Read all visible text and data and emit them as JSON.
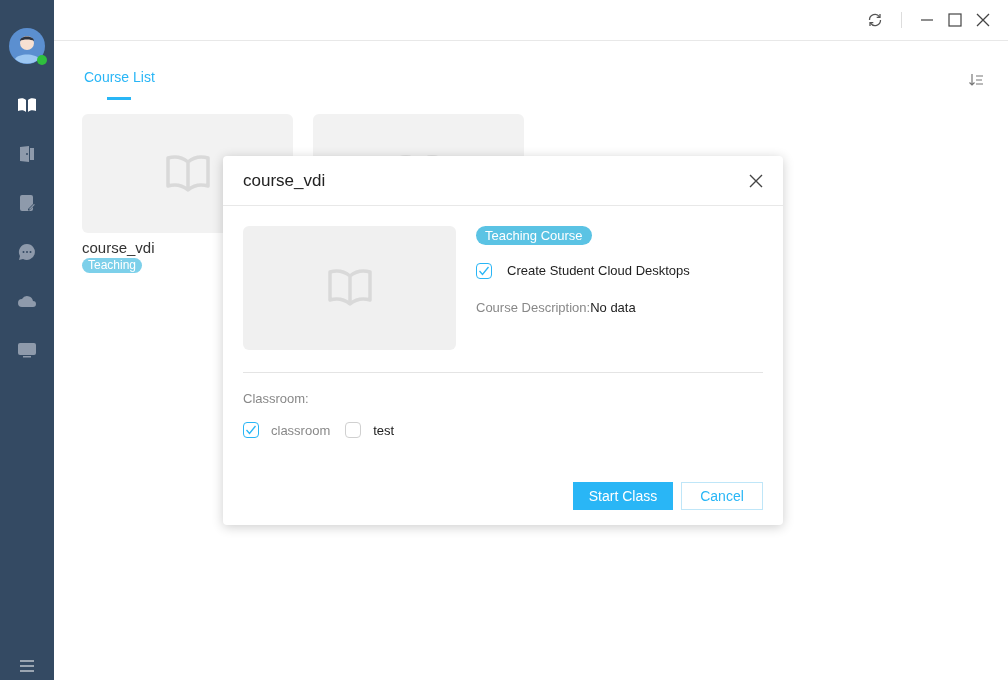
{
  "sidebar": {
    "items": [
      {
        "kind": "book",
        "selected": true
      },
      {
        "kind": "door",
        "selected": false
      },
      {
        "kind": "note",
        "selected": false
      },
      {
        "kind": "chat",
        "selected": false
      },
      {
        "kind": "cloud",
        "selected": false
      },
      {
        "kind": "monitor",
        "selected": false
      }
    ],
    "online": true
  },
  "tabs": [
    {
      "label": "Course List",
      "selected": true
    }
  ],
  "cards": [
    {
      "kind": "course",
      "title": "course_vdi",
      "tag": "Teaching"
    },
    {
      "kind": "course"
    }
  ],
  "dialog": {
    "title": "course_vdi",
    "tag": "Teaching Course",
    "option": {
      "label": "Create Student Cloud Desktops",
      "checked": true
    },
    "description_label": "Course Description:",
    "description": "No data",
    "classroom_label": "Classroom:",
    "classrooms": [
      {
        "label": "classroom",
        "checked": true
      },
      {
        "label": "test",
        "checked": false
      }
    ],
    "buttons": [
      {
        "label": "Start Class",
        "kind": "primary"
      },
      {
        "label": "Cancel",
        "kind": "secondary"
      }
    ]
  }
}
